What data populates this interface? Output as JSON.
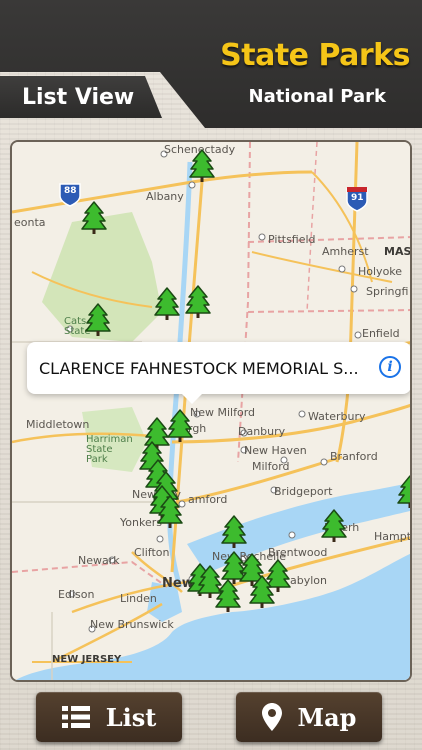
{
  "header": {
    "title": "State Parks",
    "subtitle": "National Park",
    "view_tab": "List View"
  },
  "map": {
    "labels": {
      "schenectady": "Schenectady",
      "albany": "Albany",
      "oneonta": "eonta",
      "pittsfield": "Pittsfield",
      "amherst": "Amherst",
      "mas": "MAS",
      "holyoke": "Holyoke",
      "springfield": "Springfi",
      "enfield": "Enfield",
      "catskill": "Cats State",
      "middletown": "Middletown",
      "new_milford": "New Milford",
      "waterbury": "Waterbury",
      "newburgh": "rgh",
      "danbury": "Danbury",
      "harriman": "Harriman State Park",
      "new_haven": "New Haven",
      "milford": "Milford",
      "branford": "Branford",
      "new_city": "New City",
      "stamford": "amford",
      "bridgeport": "Bridgeport",
      "yonkers": "Yonkers",
      "riverhead": "Riverh",
      "hampton": "Hampte",
      "clifton": "Clifton",
      "new_rochelle": "New Rochelle",
      "brentwood": "Brentwood",
      "newark": "Newark",
      "new_york": "New",
      "babylon": "abylon",
      "edison": "Edison",
      "linden": "Linden",
      "new_brunswick": "New Brunswick",
      "new_jersey": "NEW JERSEY",
      "hwy88": "88",
      "hwy91": "91"
    },
    "callout": {
      "title": "CLARENCE FAHNESTOCK MEMORIAL S...",
      "info_icon": "info-icon"
    }
  },
  "buttons": {
    "list": {
      "label": "List",
      "icon": "list-icon"
    },
    "map": {
      "label": "Map",
      "icon": "map-pin-icon"
    }
  },
  "colors": {
    "title": "#f5c518",
    "header_dark": "#2e2d2c",
    "button_brown": "#4a3828",
    "pin_green": "#3dbb2e",
    "water": "#a8d6f5",
    "highway": "#f5c25a"
  }
}
